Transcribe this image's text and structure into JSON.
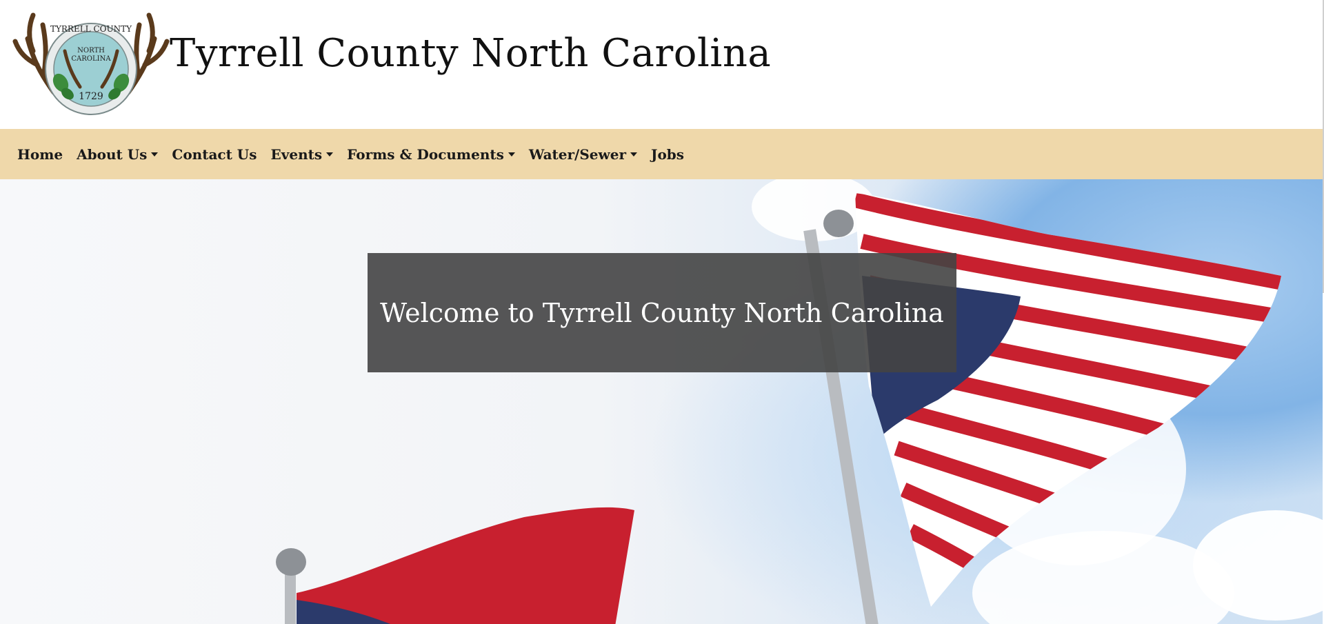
{
  "header": {
    "title": "Tyrrell County North Carolina",
    "seal": {
      "top_text": "TYRRELL COUNTY",
      "middle_text_1": "NORTH",
      "middle_text_2": "CAROLINA",
      "year": "1729"
    }
  },
  "nav": {
    "items": [
      {
        "label": "Home",
        "dropdown": false
      },
      {
        "label": "About Us",
        "dropdown": true
      },
      {
        "label": "Contact Us",
        "dropdown": false
      },
      {
        "label": "Events",
        "dropdown": true
      },
      {
        "label": "Forms & Documents",
        "dropdown": true
      },
      {
        "label": "Water/Sewer",
        "dropdown": true
      },
      {
        "label": "Jobs",
        "dropdown": false
      }
    ]
  },
  "hero": {
    "welcome": "Welcome to Tyrrell County North Carolina"
  },
  "colors": {
    "navbar_bg": "#efd8aa",
    "welcome_bg": "#444444",
    "flag_red": "#c8202f",
    "flag_blue": "#2b3a6b"
  }
}
